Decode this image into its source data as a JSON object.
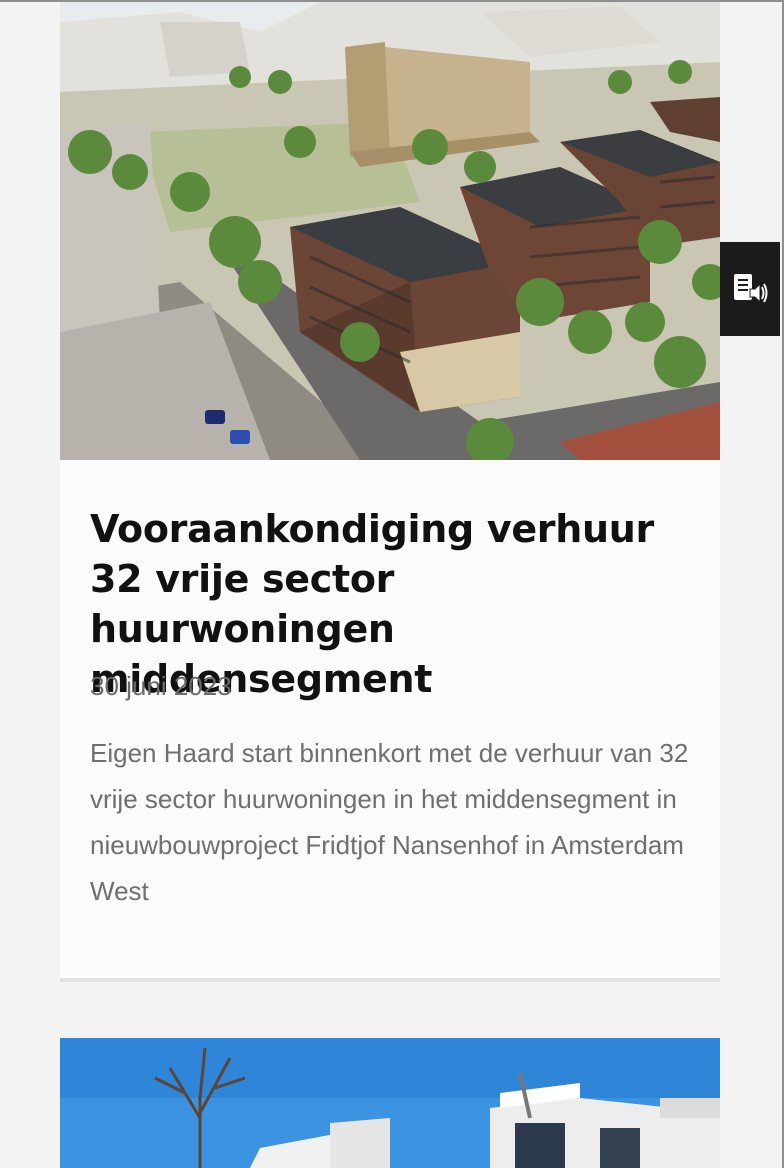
{
  "article": {
    "title": "Vooraankondiging verhuur 32 vrije sector huurwoningen middensegment",
    "date": "30 juni 2023",
    "excerpt": "Eigen Haard start binnenkort met de verhuur van 32 vrije sector huurwoningen in het middensegment in nieuwbouwproject Fridtjof Nansenhof in Amsterdam West"
  },
  "readspeaker": {
    "icon": "speaker-document-icon"
  },
  "colors": {
    "title": "#111111",
    "meta": "#6b6b6b",
    "card_background": "#fbfbfb",
    "page_background": "#f3f3f3",
    "readspeaker_background": "#1b1b1b",
    "sky_blue": "#2f8fe0"
  }
}
